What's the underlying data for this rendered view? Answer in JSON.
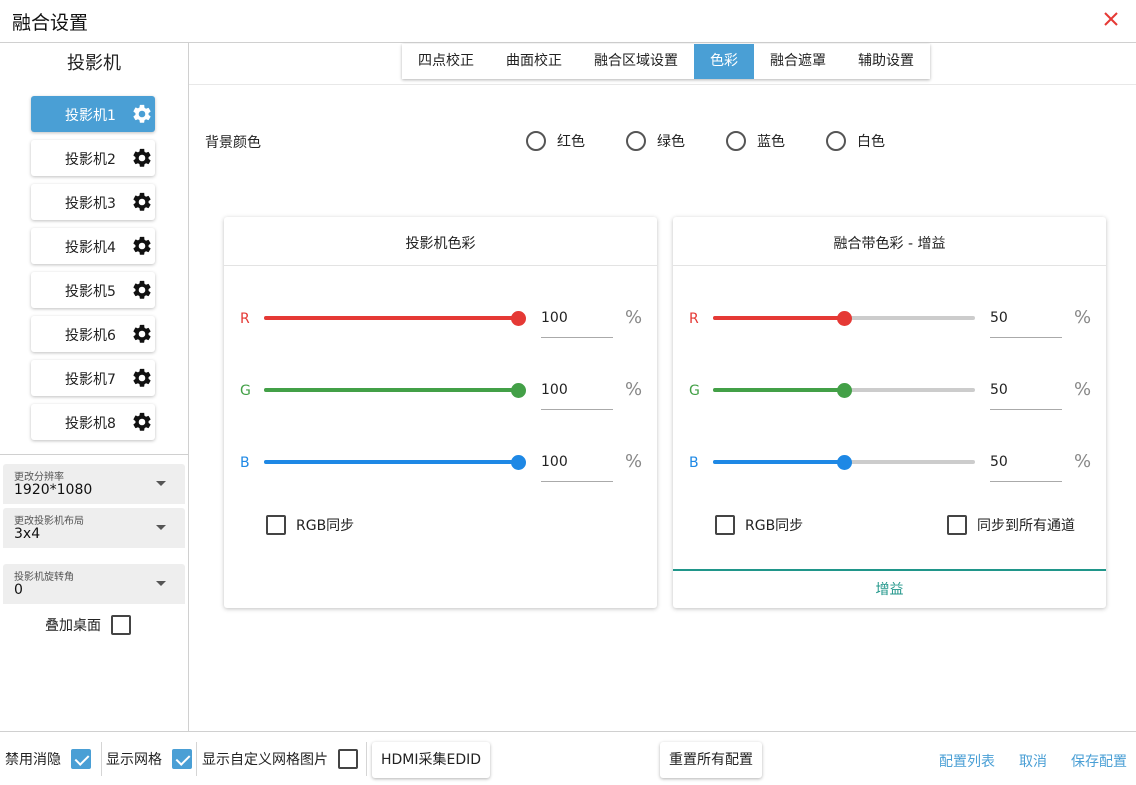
{
  "window": {
    "title": "融合设置",
    "close_color": "#e53935"
  },
  "sidebar": {
    "heading": "投影机",
    "projectors": [
      {
        "label": "投影机1",
        "active": true
      },
      {
        "label": "投影机2",
        "active": false
      },
      {
        "label": "投影机3",
        "active": false
      },
      {
        "label": "投影机4",
        "active": false
      },
      {
        "label": "投影机5",
        "active": false
      },
      {
        "label": "投影机6",
        "active": false
      },
      {
        "label": "投影机7",
        "active": false
      },
      {
        "label": "投影机8",
        "active": false
      }
    ],
    "resolution": {
      "caption": "更改分辨率",
      "value": "1920*1080"
    },
    "layout": {
      "caption": "更改投影机布局",
      "value": "3x4"
    },
    "rotation": {
      "caption": "投影机旋转角",
      "value": "0"
    },
    "overlay_desktop": {
      "label": "叠加桌面",
      "checked": false
    }
  },
  "tabs": [
    {
      "label": "四点校正",
      "active": false
    },
    {
      "label": "曲面校正",
      "active": false
    },
    {
      "label": "融合区域设置",
      "active": false
    },
    {
      "label": "色彩",
      "active": true
    },
    {
      "label": "融合遮罩",
      "active": false
    },
    {
      "label": "辅助设置",
      "active": false
    }
  ],
  "background_color": {
    "label": "背景颜色",
    "options": [
      "红色",
      "绿色",
      "蓝色",
      "白色"
    ]
  },
  "projector_color": {
    "title": "投影机色彩",
    "channels": [
      {
        "label": "R",
        "value": "100",
        "fraction": 1.0,
        "color": "#e53935"
      },
      {
        "label": "G",
        "value": "100",
        "fraction": 1.0,
        "color": "#43a047"
      },
      {
        "label": "B",
        "value": "100",
        "fraction": 1.0,
        "color": "#1e88e5"
      }
    ],
    "unit": "%",
    "rgb_sync": {
      "label": "RGB同步",
      "checked": false
    }
  },
  "blend_color": {
    "title": "融合带色彩 - 增益",
    "channels": [
      {
        "label": "R",
        "value": "50",
        "fraction": 0.5,
        "color": "#e53935"
      },
      {
        "label": "G",
        "value": "50",
        "fraction": 0.5,
        "color": "#43a047"
      },
      {
        "label": "B",
        "value": "50",
        "fraction": 0.5,
        "color": "#1e88e5"
      }
    ],
    "unit": "%",
    "rgb_sync": {
      "label": "RGB同步",
      "checked": false
    },
    "sync_all": {
      "label": "同步到所有通道",
      "checked": false
    },
    "footer_tab": "增益"
  },
  "bottom": {
    "disable_blank": {
      "label": "禁用消隐",
      "checked": true
    },
    "show_grid": {
      "label": "显示网格",
      "checked": true
    },
    "show_custom_grid": {
      "label": "显示自定义网格图片",
      "checked": false
    },
    "hdmi_edid": "HDMI采集EDID",
    "reset_all": "重置所有配置",
    "config_list": "配置列表",
    "cancel": "取消",
    "save": "保存配置"
  }
}
